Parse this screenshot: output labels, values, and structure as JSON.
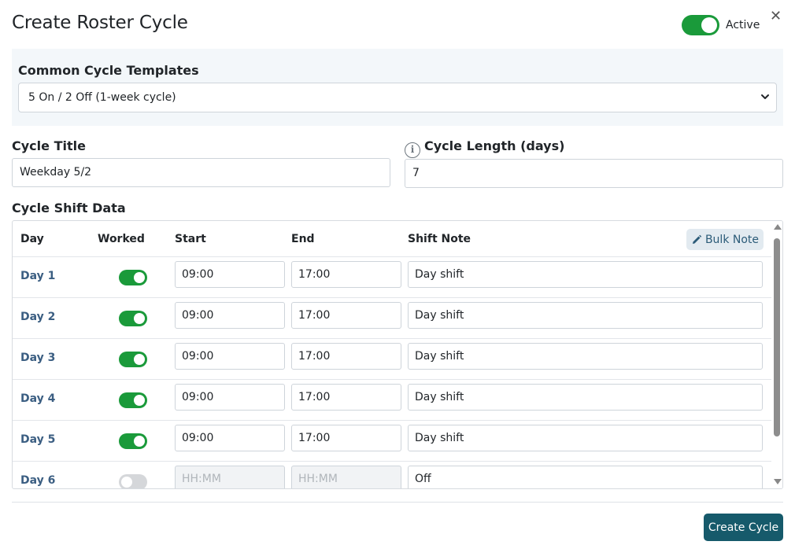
{
  "dialog": {
    "title": "Create Roster Cycle",
    "active_label": "Active",
    "active_on": true,
    "close_glyph": "✕"
  },
  "templates": {
    "label": "Common Cycle Templates",
    "selected": "5 On / 2 Off (1-week cycle)"
  },
  "fields": {
    "title_label": "Cycle Title",
    "title_value": "Weekday 5/2",
    "length_label": "Cycle Length (days)",
    "length_value": "7",
    "info_glyph": "i"
  },
  "shift_data": {
    "label": "Cycle Shift Data",
    "columns": {
      "day": "Day",
      "worked": "Worked",
      "start": "Start",
      "end": "End",
      "note": "Shift Note"
    },
    "bulk_note": "Bulk Note",
    "placeholder_time": "HH:MM",
    "rows": [
      {
        "day": "Day 1",
        "worked": true,
        "start": "09:00",
        "end": "17:00",
        "note": "Day shift"
      },
      {
        "day": "Day 2",
        "worked": true,
        "start": "09:00",
        "end": "17:00",
        "note": "Day shift"
      },
      {
        "day": "Day 3",
        "worked": true,
        "start": "09:00",
        "end": "17:00",
        "note": "Day shift"
      },
      {
        "day": "Day 4",
        "worked": true,
        "start": "09:00",
        "end": "17:00",
        "note": "Day shift"
      },
      {
        "day": "Day 5",
        "worked": true,
        "start": "09:00",
        "end": "17:00",
        "note": "Day shift"
      },
      {
        "day": "Day 6",
        "worked": false,
        "start": "",
        "end": "",
        "note": "Off"
      }
    ]
  },
  "footer": {
    "create_label": "Create Cycle"
  },
  "colors": {
    "accent_green": "#1a9a3a",
    "primary_button": "#165a6b",
    "day_label": "#3b5e82"
  },
  "icons": {
    "close": "close-icon",
    "info": "info-icon",
    "pencil": "pencil-icon",
    "caret": "chevron-down-icon"
  }
}
